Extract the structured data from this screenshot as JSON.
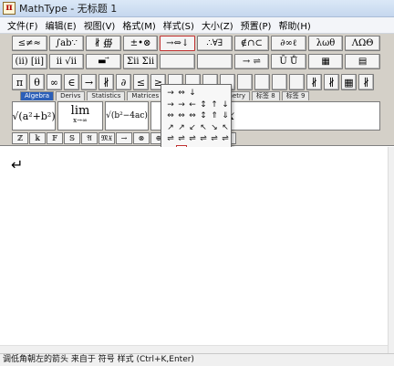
{
  "window": {
    "title": "MathType - 无标题 1",
    "app_icon_glyph": "π"
  },
  "menu": [
    "文件(F)",
    "编辑(E)",
    "视图(V)",
    "格式(M)",
    "样式(S)",
    "大小(Z)",
    "预置(P)",
    "帮助(H)"
  ],
  "toolbar": {
    "row1": [
      "≤≠≈",
      "∫ab∵",
      "∦ ∰",
      "±•⊗",
      "→⇔↓",
      "∴∀∃",
      "∉∩⊂",
      "∂∞ℓ",
      "λωθ",
      "ΛΩΘ"
    ],
    "row2": [
      "(ⅱ) [ⅱ]",
      "ⅱ √ⅱ",
      "▬ ⃗",
      "Σⅱ Σⅱ",
      "",
      "",
      "→ ⇌",
      "Ū Ů",
      "▦",
      "▤"
    ],
    "row3": [
      "π",
      "θ",
      "∞",
      "∈",
      "→",
      "∦",
      "∂",
      "≤",
      "≥",
      "",
      "",
      "",
      "",
      "",
      "",
      "",
      "",
      "∦",
      "∦",
      "▦",
      "∦"
    ],
    "tabs": [
      "Algebra",
      "Derivs",
      "Statistics",
      "Matrices",
      "",
      "",
      "",
      "",
      "Geometry",
      "标签 8",
      "标签 9"
    ],
    "templates": [
      "√(a²+b²)",
      "lim",
      "x→∞",
      "√(b²−4ac)",
      "→/",
      "log",
      "a",
      "x"
    ],
    "small_row": [
      "ℤ",
      "𝕜",
      "𝔽",
      "𝕊",
      "𝔄",
      "𝔐𝔛",
      "→",
      "⊗",
      "⊕",
      "◁",
      "▷",
      "∞",
      "√"
    ]
  },
  "arrow_palette": {
    "cells": [
      "→",
      "⇔",
      "↓",
      "",
      "",
      "",
      "→",
      "→",
      "←",
      "↕",
      "↑",
      "↓",
      "⇔",
      "⇔",
      "⇔",
      "↕",
      "⇑",
      "⇓",
      "↗",
      "↗",
      "↙",
      "↖",
      "↘",
      "↖",
      "⇌",
      "⇌",
      "⇌",
      "⇌",
      "⇌",
      "⇌",
      "↦",
      "↵",
      "",
      "",
      "",
      ""
    ],
    "selected_index": 31
  },
  "editor": {
    "content_glyph": "↵"
  },
  "statusbar": {
    "text": "调低角朝左的箭头 来自于 符号 样式 (Ctrl+K,Enter)"
  }
}
